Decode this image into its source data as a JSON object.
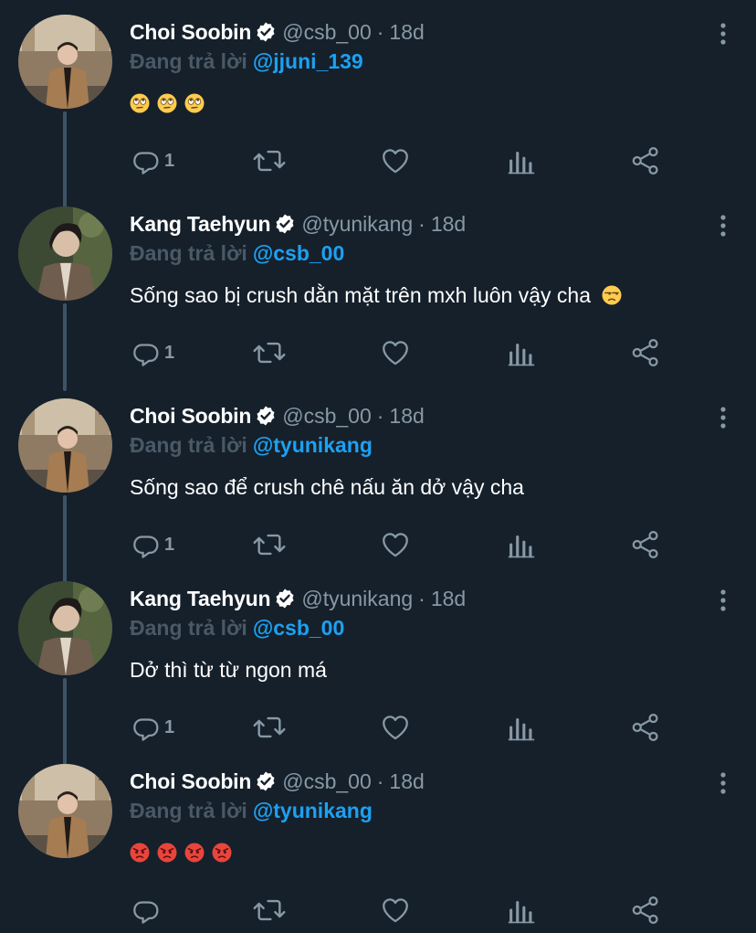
{
  "colors": {
    "background": "#15202b",
    "name": "#ffffff",
    "muted": "#8899a6",
    "link": "#1da1f2",
    "connector": "#3d5466"
  },
  "tweets": [
    {
      "name": "Choi Soobin",
      "handle": "@csb_00",
      "separator": "·",
      "time": "18d",
      "replying_label": "Đang trả lời",
      "replying_to": "@jjuni_139",
      "text": "",
      "emojis": [
        "face-with-rolling-eyes",
        "face-with-rolling-eyes",
        "face-with-rolling-eyes"
      ],
      "reply_count": "1",
      "avatar": "soobin-avatar"
    },
    {
      "name": "Kang Taehyun",
      "handle": "@tyunikang",
      "separator": "·",
      "time": "18d",
      "replying_label": "Đang trả lời",
      "replying_to": "@csb_00",
      "text": "Sống sao bị crush dằn mặt trên mxh luôn vậy cha",
      "emojis": [
        "unamused-face"
      ],
      "reply_count": "1",
      "avatar": "taehyun-avatar"
    },
    {
      "name": "Choi Soobin",
      "handle": "@csb_00",
      "separator": "·",
      "time": "18d",
      "replying_label": "Đang trả lời",
      "replying_to": "@tyunikang",
      "text": "Sống sao để crush chê nấu ăn dở vậy cha",
      "emojis": [],
      "reply_count": "1",
      "avatar": "soobin-avatar"
    },
    {
      "name": "Kang Taehyun",
      "handle": "@tyunikang",
      "separator": "·",
      "time": "18d",
      "replying_label": "Đang trả lời",
      "replying_to": "@csb_00",
      "text": "Dở thì từ từ ngon má",
      "emojis": [],
      "reply_count": "1",
      "avatar": "taehyun-avatar"
    },
    {
      "name": "Choi Soobin",
      "handle": "@csb_00",
      "separator": "·",
      "time": "18d",
      "replying_label": "Đang trả lời",
      "replying_to": "@tyunikang",
      "text": "",
      "emojis": [
        "angry-face",
        "angry-face",
        "angry-face",
        "angry-face"
      ],
      "reply_count": "",
      "avatar": "soobin-avatar"
    }
  ]
}
